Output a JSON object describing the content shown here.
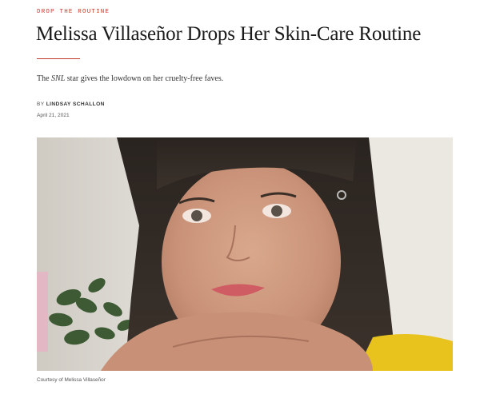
{
  "article": {
    "kicker": "DROP THE ROUTINE",
    "headline": "Melissa Villaseñor Drops Her Skin-Care Routine",
    "dek": {
      "prefix": "The ",
      "italic": "SNL",
      "suffix": " star gives the lowdown on her cruelty-free faves."
    },
    "byline": {
      "prefix": "BY ",
      "author": "LINDSAY SCHALLON"
    },
    "date": "April 21, 2021",
    "image_caption": "Courtesy of Melissa Villaseñor"
  },
  "colors": {
    "accent": "#c0392b",
    "text": "#1a1a1a"
  }
}
